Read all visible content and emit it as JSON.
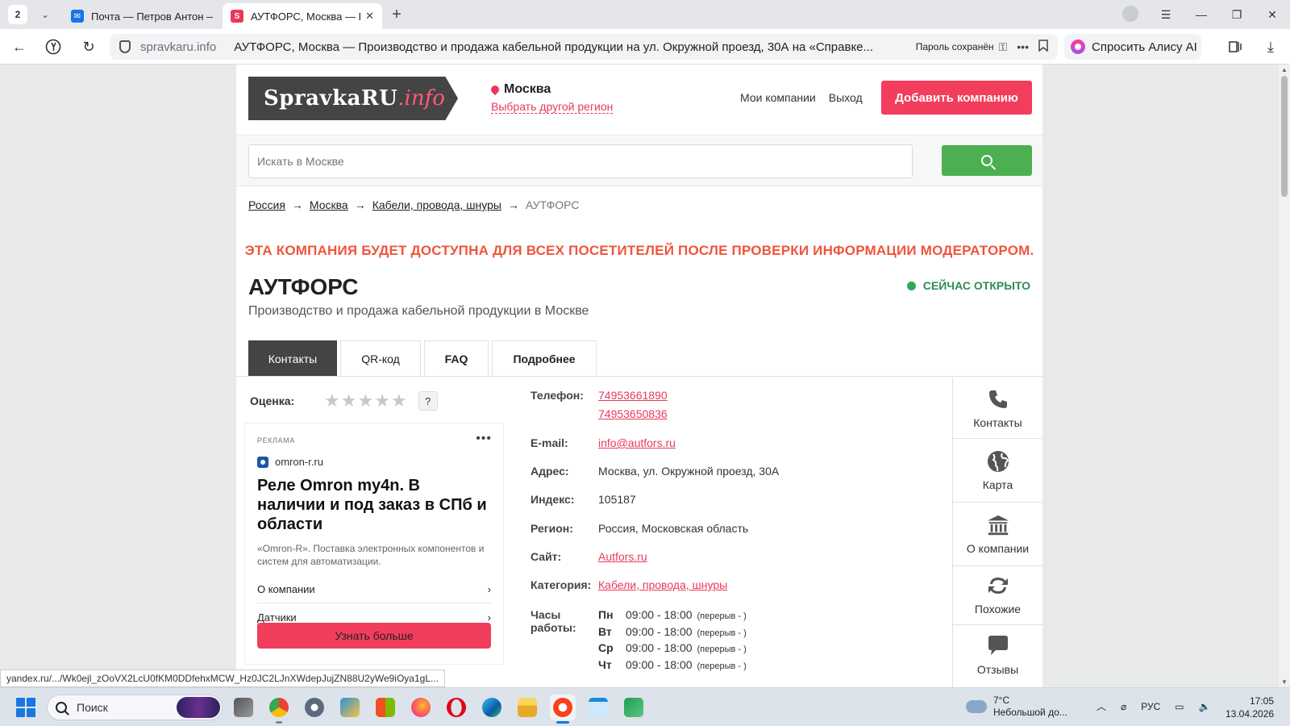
{
  "browser": {
    "tab_count": "2",
    "tabs": [
      {
        "title": "Почта — Петров Антон —",
        "favicon_color": "#1a73e8"
      },
      {
        "title": "АУТФОРС, Москва — Г",
        "favicon_color": "#e8395a",
        "favicon_letter": "S"
      }
    ],
    "url_domain": "spravkaru.info",
    "url_title": "АУТФОРС, Москва — Производство и продажа кабельной продукции на ул. Окружной проезд, 30А на «Справке...",
    "password_saved": "Пароль сохранён",
    "alice_label": "Спросить Алису AI"
  },
  "site": {
    "logo_main": "SpravkaRU",
    "logo_ext": ".info",
    "city": "Москва",
    "change_region": "Выбрать другой регион",
    "link_my_companies": "Мои компании",
    "link_logout": "Выход",
    "add_company": "Добавить компанию",
    "search_placeholder": "Искать в Москве"
  },
  "breadcrumb": {
    "items": [
      "Россия",
      "Москва",
      "Кабели, провода, шнуры"
    ],
    "current": "АУТФОРС",
    "separator": "→"
  },
  "moderation_notice": "ЭТА КОМПАНИЯ БУДЕТ ДОСТУПНА ДЛЯ ВСЕХ ПОСЕТИТЕЛЕЙ ПОСЛЕ ПРОВЕРКИ ИНФОРМАЦИИ МОДЕРАТОРОМ.",
  "company": {
    "name": "АУТФОРС",
    "description": "Производство и продажа кабельной продукции в Москве",
    "status": "СЕЙЧАС ОТКРЫТО"
  },
  "page_tabs": [
    "Контакты",
    "QR-код",
    "FAQ",
    "Подробнее"
  ],
  "rating": {
    "label": "Оценка:",
    "stars_filled": 0,
    "stars_total": 5,
    "help": "?"
  },
  "ad": {
    "label": "РЕКЛАМА",
    "more": "•••",
    "domain": "omron-r.ru",
    "title": "Реле Omron my4n. В наличии и под заказ в СПб и области",
    "text": "«Omron-R». Поставка электронных компонентов и систем для автоматизации.",
    "links": [
      "О компании",
      "Датчики"
    ],
    "cta": "Узнать больше"
  },
  "contacts": {
    "phone_label": "Телефон:",
    "phones": [
      "74953661890",
      "74953650836"
    ],
    "email_label": "E-mail:",
    "email": "info@autfors.ru",
    "address_label": "Адрес:",
    "address": "Москва, ул. Окружной проезд, 30А",
    "index_label": "Индекс:",
    "index": "105187",
    "region_label": "Регион:",
    "region": "Россия, Московская область",
    "site_label": "Сайт:",
    "site": "Autfors.ru",
    "category_label": "Категория:",
    "category": "Кабели, провода, шнуры",
    "hours_label_1": "Часы",
    "hours_label_2": "работы:",
    "hours": [
      {
        "day": "Пн",
        "time": "09:00 - 18:00",
        "break": "(перерыв - )"
      },
      {
        "day": "Вт",
        "time": "09:00 - 18:00",
        "break": "(перерыв - )"
      },
      {
        "day": "Ср",
        "time": "09:00 - 18:00",
        "break": "(перерыв - )"
      },
      {
        "day": "Чт",
        "time": "09:00 - 18:00",
        "break": "(перерыв - )"
      }
    ]
  },
  "sidenav": [
    "Контакты",
    "Карта",
    "О компании",
    "Похожие",
    "Отзывы"
  ],
  "status_url": "yandex.ru/.../Wk0ejl_zOoVX2LcU0fKM0DDfehxMCW_Hz0JC2LJnXWdepJujZN88U2yWe9iOya1gL...",
  "taskbar": {
    "search_label": "Поиск",
    "weather_temp": "7°C",
    "weather_desc": "Небольшой до...",
    "lang": "РУС",
    "time": "17:05",
    "date": "13.04.2026"
  }
}
